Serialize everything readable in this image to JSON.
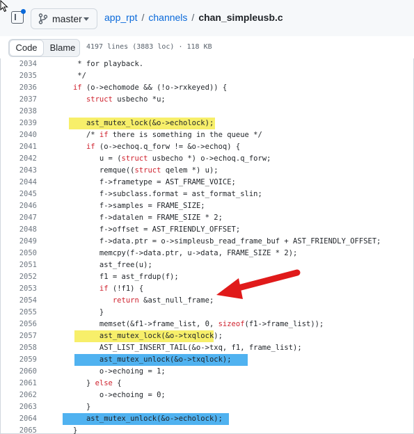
{
  "colors": {
    "highlight_yellow": "#f7ef6a",
    "highlight_blue": "#50b2f0",
    "arrow_red": "#e01a1a",
    "keyword": "#cf222e",
    "link": "#0969da"
  },
  "icons": [
    "sidebar-toggle-icon",
    "git-branch-icon",
    "chevron-down-icon",
    "red-arrow-icon",
    "mouse-cursor-icon"
  ],
  "header": {
    "branch": "master",
    "breadcrumb": {
      "repo": "app_rpt",
      "sep1": "/",
      "folder": "channels",
      "sep2": "/",
      "file": "chan_simpleusb.c"
    }
  },
  "toolbar": {
    "code_tab": "Code",
    "blame_tab": "Blame",
    "file_info": "4197 lines (3883 loc) · 118 KB"
  },
  "code": {
    "lines": [
      {
        "num": "2034",
        "text": "\t * for playback."
      },
      {
        "num": "2035",
        "text": "\t */"
      },
      {
        "num": "2036",
        "text": "\tif (o->echomode && (!o->rxkeyed)) {"
      },
      {
        "num": "2037",
        "text": "\t\tstruct usbecho *u;"
      },
      {
        "num": "2038",
        "text": ""
      },
      {
        "num": "2039",
        "text": "\t\tast_mutex_lock(&o->echolock);",
        "highlight": "yellow"
      },
      {
        "num": "2040",
        "text": "\t\t/* if there is something in the queue */"
      },
      {
        "num": "2041",
        "text": "\t\tif (o->echoq.q_forw != &o->echoq) {"
      },
      {
        "num": "2042",
        "text": "\t\t\tu = (struct usbecho *) o->echoq.q_forw;"
      },
      {
        "num": "2043",
        "text": "\t\t\tremque((struct qelem *) u);"
      },
      {
        "num": "2044",
        "text": "\t\t\tf->frametype = AST_FRAME_VOICE;"
      },
      {
        "num": "2045",
        "text": "\t\t\tf->subclass.format = ast_format_slin;"
      },
      {
        "num": "2046",
        "text": "\t\t\tf->samples = FRAME_SIZE;"
      },
      {
        "num": "2047",
        "text": "\t\t\tf->datalen = FRAME_SIZE * 2;"
      },
      {
        "num": "2048",
        "text": "\t\t\tf->offset = AST_FRIENDLY_OFFSET;"
      },
      {
        "num": "2049",
        "text": "\t\t\tf->data.ptr = o->simpleusb_read_frame_buf + AST_FRIENDLY_OFFSET;"
      },
      {
        "num": "2050",
        "text": "\t\t\tmemcpy(f->data.ptr, u->data, FRAME_SIZE * 2);"
      },
      {
        "num": "2051",
        "text": "\t\t\tast_free(u);"
      },
      {
        "num": "2052",
        "text": "\t\t\tf1 = ast_frdup(f);"
      },
      {
        "num": "2053",
        "text": "\t\t\tif (!f1) {"
      },
      {
        "num": "2054",
        "text": "\t\t\t\treturn &ast_null_frame;"
      },
      {
        "num": "2055",
        "text": "\t\t\t}"
      },
      {
        "num": "2056",
        "text": "\t\t\tmemset(&f1->frame_list, 0, sizeof(f1->frame_list));"
      },
      {
        "num": "2057",
        "text": "\t\t\tast_mutex_lock(&o->txqlock);",
        "highlight": "yellow"
      },
      {
        "num": "2058",
        "text": "\t\t\tAST_LIST_INSERT_TAIL(&o->txq, f1, frame_list);"
      },
      {
        "num": "2059",
        "text": "\t\t\tast_mutex_unlock(&o->txqlock);",
        "highlight": "blue"
      },
      {
        "num": "2060",
        "text": "\t\t\to->echoing = 1;"
      },
      {
        "num": "2061",
        "text": "\t\t} else {"
      },
      {
        "num": "2062",
        "text": "\t\t\to->echoing = 0;"
      },
      {
        "num": "2063",
        "text": "\t\t}"
      },
      {
        "num": "2064",
        "text": "\t\tast_mutex_unlock(&o->echolock);",
        "highlight": "blue"
      },
      {
        "num": "2065",
        "text": "\t}"
      }
    ]
  }
}
